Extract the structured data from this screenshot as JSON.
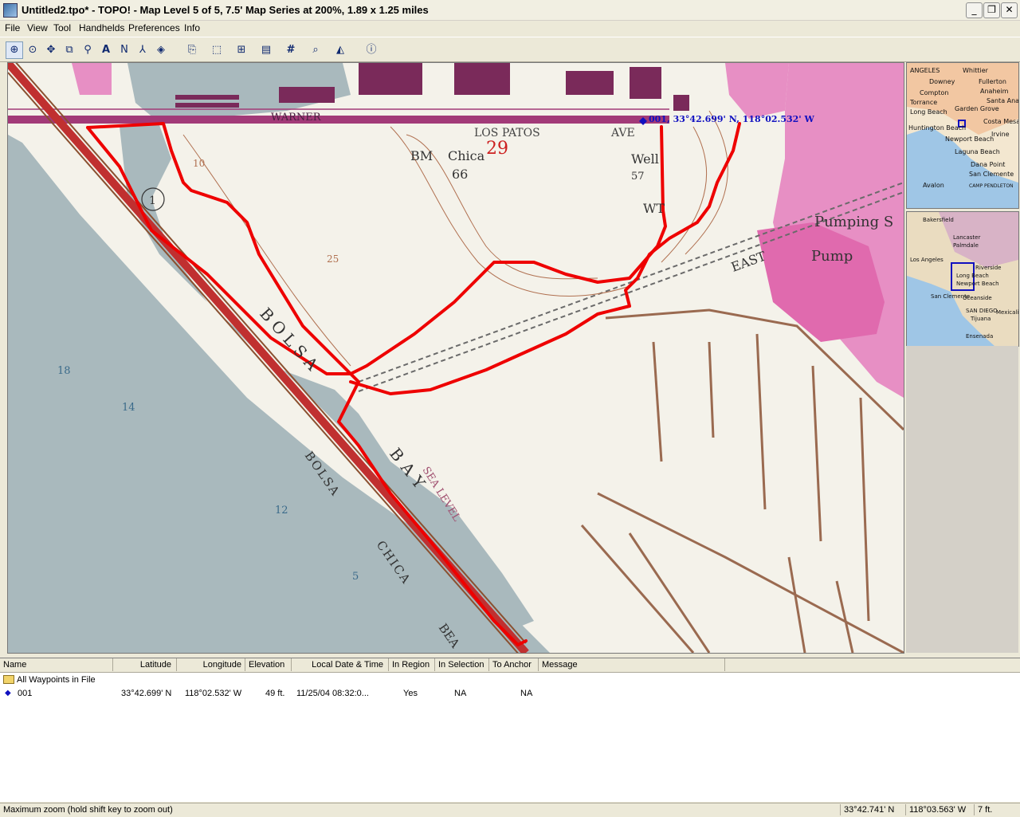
{
  "window": {
    "title": "Untitled2.tpo* - TOPO! - Map Level 5 of 5, 7.5' Map Series at 200%, 1.89 x 1.25 miles",
    "minimize": "_",
    "maximize": "❐",
    "close": "✕"
  },
  "menu": {
    "items": [
      {
        "label": "File",
        "key": "F"
      },
      {
        "label": "View",
        "key": "V"
      },
      {
        "label": "Tool",
        "key": "T"
      },
      {
        "label": "Handhelds",
        "key": "H"
      },
      {
        "label": "Preferences",
        "key": "P"
      },
      {
        "label": "Info",
        "key": "I"
      }
    ]
  },
  "toolbar": {
    "tools": [
      {
        "name": "zoom-in-tool",
        "glyph": "⊕"
      },
      {
        "name": "center-tool",
        "glyph": "⊙"
      },
      {
        "name": "pan-tool",
        "glyph": "✥"
      },
      {
        "name": "copy-tool",
        "glyph": "⧉"
      },
      {
        "name": "pushpin-tool",
        "glyph": "⚲"
      },
      {
        "name": "text-tool",
        "glyph": "A"
      },
      {
        "name": "route-tool",
        "glyph": "N"
      },
      {
        "name": "trail-tool",
        "glyph": "⅄"
      },
      {
        "name": "waypoint-tool",
        "glyph": "◈"
      },
      {
        "name": "open-tool",
        "glyph": "⎘"
      },
      {
        "name": "select-tool",
        "glyph": "⬚"
      },
      {
        "name": "handheld-tool",
        "glyph": "⊞"
      },
      {
        "name": "gps-tool",
        "glyph": "▤"
      },
      {
        "name": "grid-tool",
        "glyph": "#"
      },
      {
        "name": "search-tool",
        "glyph": "⌕"
      },
      {
        "name": "profile-tool",
        "glyph": "◭"
      },
      {
        "name": "info-tool",
        "glyph": "ⓘ"
      }
    ]
  },
  "map": {
    "waypoint_label": "001, 33°42.699' N, 118°02.532' W",
    "labels": {
      "warner": "WARNER",
      "los_patos": "LOS PATOS",
      "ave": "AVE",
      "bm": "BM",
      "chica": "Chica",
      "elev66": "66",
      "sec29": "29",
      "well": "Well",
      "well57": "57",
      "wt": "WT",
      "pumping": "Pumping S",
      "pump": "Pump",
      "east": "EAST",
      "bolsa1": "BOLSA",
      "bay": "BAY",
      "bolsa2": "BOLSA",
      "chica2": "CHICA",
      "bea": "BEA",
      "sea_level": "SEA LEVEL",
      "c10": "10",
      "c25": "25",
      "d18": "18",
      "d14": "14",
      "d12": "12",
      "d5": "5",
      "route1": "1"
    }
  },
  "overview": {
    "upper": [
      "ANGELES",
      "Whittier",
      "Downey",
      "Compton",
      "Torrance",
      "Long Beach",
      "Garden Grove",
      "Fullerton",
      "Anaheim",
      "Santa Ana",
      "Costa Mesa",
      "Huntington Beach",
      "Newport Beach",
      "Irvine",
      "Laguna Beach",
      "Dana Point",
      "San Clemente",
      "Avalon",
      "CAMP PENDLETON"
    ],
    "lower": [
      "Bakersfield",
      "Lancaster",
      "Palmdale",
      "Los Angeles",
      "Long Beach",
      "Riverside",
      "Newport Beach",
      "San Clemente",
      "Oceanside",
      "SAN DIEGO",
      "Tijuana",
      "Mexicali",
      "Ensenada"
    ]
  },
  "table": {
    "columns": [
      "Name",
      "Latitude",
      "Longitude",
      "Elevation",
      "Local Date & Time",
      "In Region",
      "In Selection",
      "To Anchor",
      "Message"
    ],
    "folder_label": "All Waypoints in File",
    "rows": [
      {
        "name": "001",
        "latitude": "33°42.699' N",
        "longitude": "118°02.532' W",
        "elevation": "49 ft.",
        "datetime": "11/25/04 08:32:0...",
        "in_region": "Yes",
        "in_selection": "NA",
        "to_anchor": "NA",
        "message": ""
      }
    ]
  },
  "status": {
    "message": "Maximum zoom (hold shift key to zoom out)",
    "lat": "33°42.741' N",
    "lon": "118°03.563' W",
    "elev": "7 ft."
  },
  "colors": {
    "route": "#ee0000",
    "urban": "#e070b0",
    "water": "#a9b9bd",
    "contour": "#b07050",
    "waypoint": "#1010c0"
  }
}
